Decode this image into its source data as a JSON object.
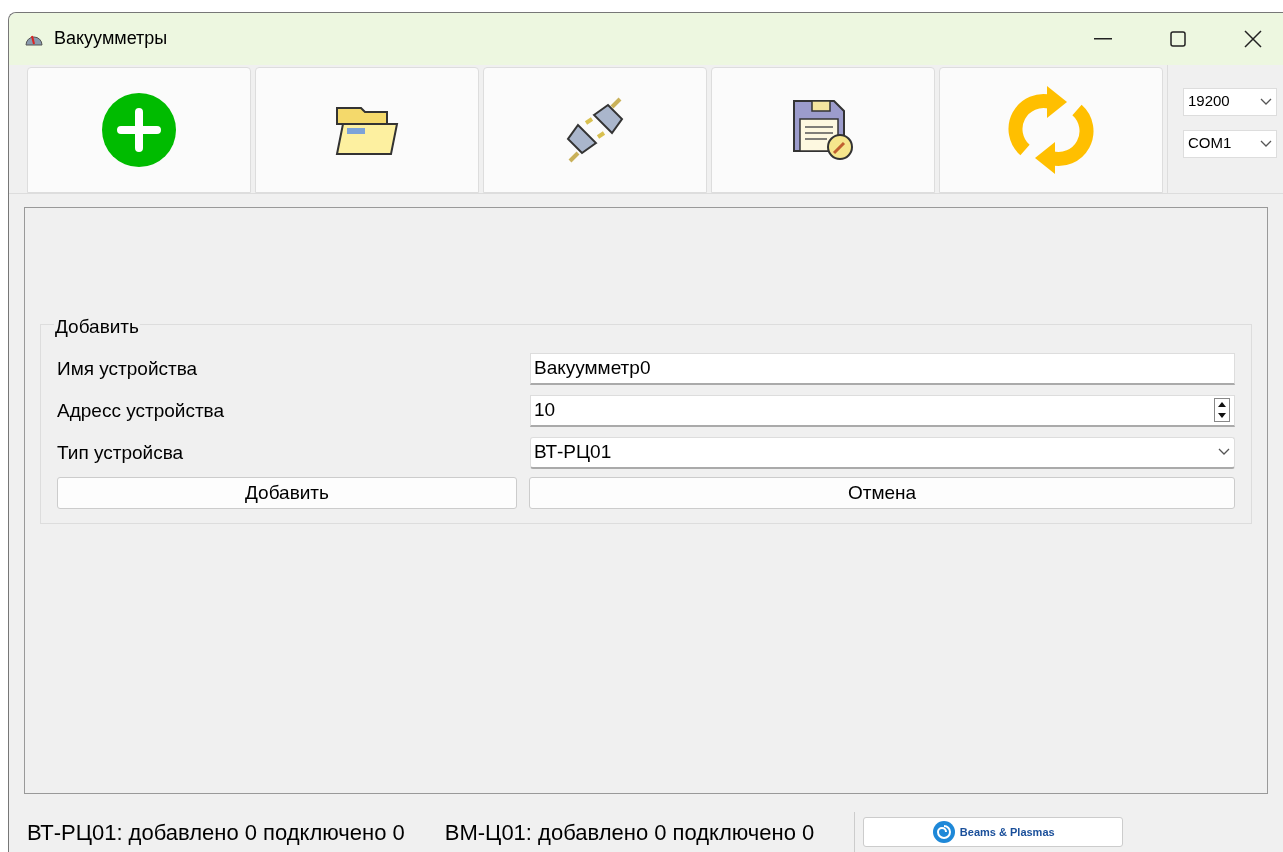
{
  "window": {
    "title": "Вакуумметры"
  },
  "toolbar": {
    "buttons": [
      {
        "kind": "add"
      },
      {
        "kind": "open"
      },
      {
        "kind": "connect"
      },
      {
        "kind": "save"
      },
      {
        "kind": "refresh"
      }
    ],
    "baud_rate": "19200",
    "port": "COM1"
  },
  "add_group": {
    "title": "Добавить",
    "fields": [
      {
        "kind": "text",
        "label": "Имя устройства",
        "value": "Вакуумметр0"
      },
      {
        "kind": "spin",
        "label": "Адресс устройства",
        "value": "10"
      },
      {
        "kind": "combo",
        "label": "Тип устройсва",
        "value": "ВТ-РЦ01"
      }
    ],
    "buttons": [
      "Добавить",
      "Отмена"
    ]
  },
  "status_bar": {
    "items": [
      "ВТ-РЦ01: добавлено 0 подключено 0",
      "ВМ-Ц01: добавлено 0 подключено 0"
    ],
    "logo": "Beams & Plasmas"
  }
}
